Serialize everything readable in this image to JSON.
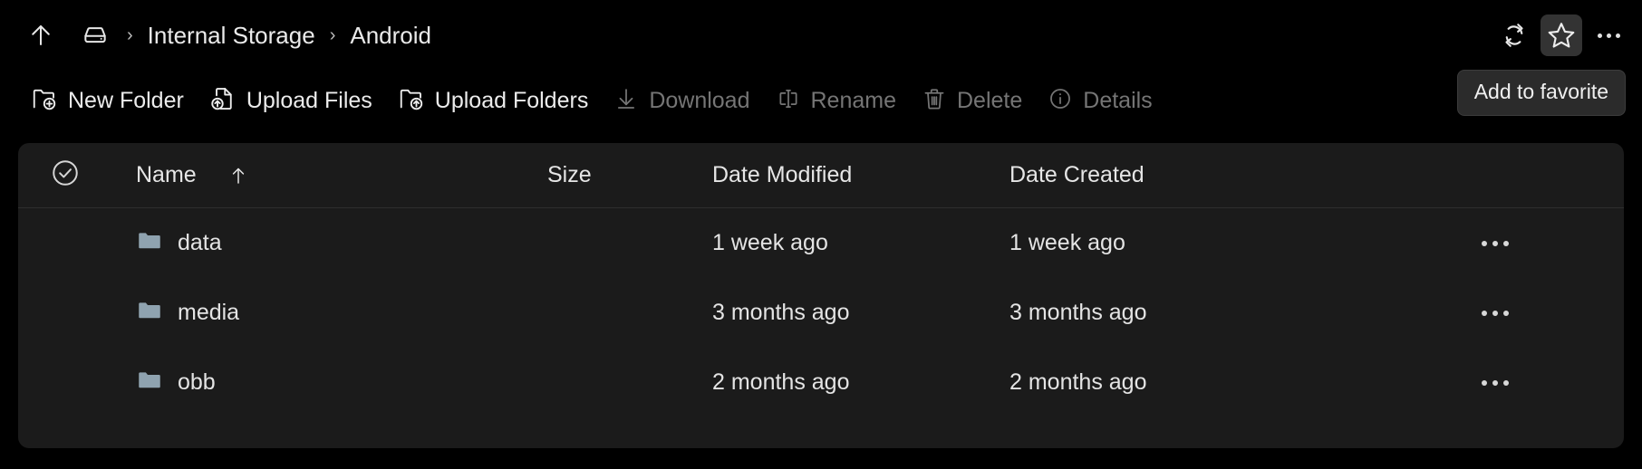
{
  "breadcrumb": {
    "up_icon": "arrow-up-icon",
    "drive_icon": "drive-icon",
    "separator": "›",
    "items": [
      {
        "label": "Internal Storage"
      },
      {
        "label": "Android"
      }
    ]
  },
  "bar_right": {
    "refresh_icon": "refresh-icon",
    "favorite_icon": "star-icon",
    "more_icon": "more-horizontal-icon",
    "tooltip": "Add to favorite"
  },
  "toolbar": {
    "items": [
      {
        "label": "New Folder",
        "icon": "folder-plus-icon",
        "disabled": false
      },
      {
        "label": "Upload Files",
        "icon": "file-upload-icon",
        "disabled": false
      },
      {
        "label": "Upload Folders",
        "icon": "folder-upload-icon",
        "disabled": false
      },
      {
        "label": "Download",
        "icon": "download-icon",
        "disabled": true
      },
      {
        "label": "Rename",
        "icon": "rename-icon",
        "disabled": true
      },
      {
        "label": "Delete",
        "icon": "trash-icon",
        "disabled": true
      },
      {
        "label": "Details",
        "icon": "info-icon",
        "disabled": true
      }
    ]
  },
  "table": {
    "select_all_icon": "check-circle-icon",
    "sort_column": "Name",
    "sort_direction": "ascending",
    "columns": {
      "name": "Name",
      "size": "Size",
      "date_modified": "Date Modified",
      "date_created": "Date Created"
    },
    "row_menu_icon": "more-horizontal-icon",
    "rows": [
      {
        "icon": "folder-icon",
        "name": "data",
        "size": "",
        "date_modified": "1 week ago",
        "date_created": "1 week ago"
      },
      {
        "icon": "folder-icon",
        "name": "media",
        "size": "",
        "date_modified": "3 months ago",
        "date_created": "3 months ago"
      },
      {
        "icon": "folder-icon",
        "name": "obb",
        "size": "",
        "date_modified": "2 months ago",
        "date_created": "2 months ago"
      }
    ]
  },
  "colors": {
    "background": "#000000",
    "panel": "#1b1b1b",
    "text": "#e8e8e8",
    "disabled_text": "#757575",
    "folder": "#8fa3b0",
    "hover": "#333333",
    "tooltip_bg": "#2b2b2b"
  }
}
